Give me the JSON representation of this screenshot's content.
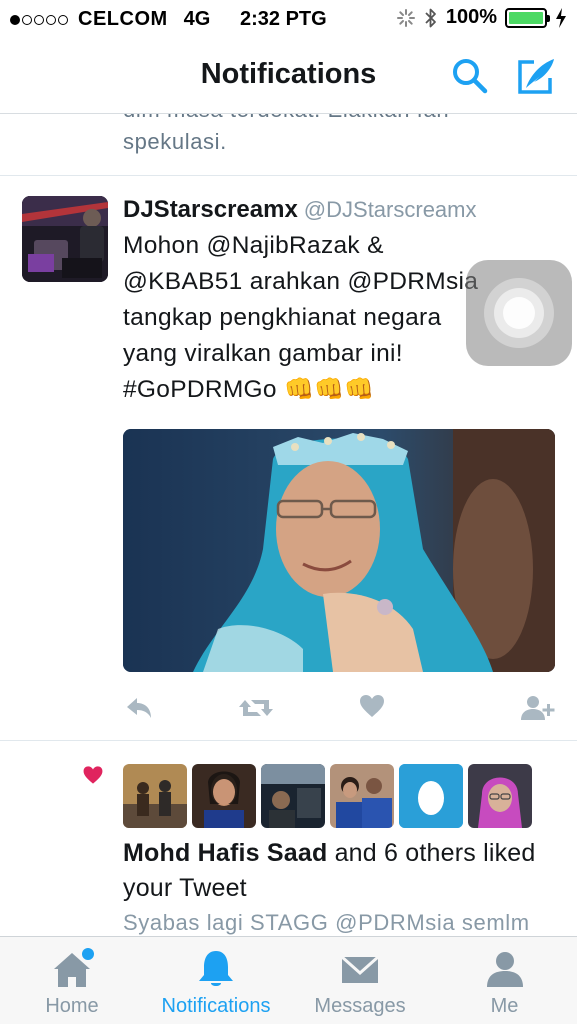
{
  "status_bar": {
    "signal_bars_filled": 1,
    "signal_bars_total": 5,
    "carrier": "CELCOM",
    "network": "4G",
    "time": "2:32 PTG",
    "battery": "100%",
    "battery_level": 1.0
  },
  "header": {
    "title": "Notifications",
    "search_icon": "search-icon",
    "compose_icon": "compose-icon"
  },
  "previous_tweet": {
    "text_line1": "dlm masa terdekat. Elakkan fan",
    "text_line2": "spekulasi."
  },
  "tweet": {
    "name": "DJStarscreamx",
    "handle": "@DJStarscreamx",
    "lines": [
      "Mohon @NajibRazak &",
      "@KBAB51 arahkan @PDRMsia",
      "tangkap pengkhianat negara",
      "yang viralkan gambar ini!"
    ],
    "hashtag": "#GoPDRMGo",
    "emoji": [
      "👊",
      "👊",
      "👊"
    ],
    "actions": [
      "reply-icon",
      "retweet-icon",
      "like-icon",
      "follow-icon"
    ]
  },
  "like_notification": {
    "name": "Mohd Hafis Saad",
    "text": " and 6 others liked your Tweet",
    "preview": "Syabas lagi STAGG @PDRMsia semlm",
    "avatar_count": 6
  },
  "tabs": [
    {
      "label": "Home",
      "icon": "home-icon",
      "active": false,
      "badge": true
    },
    {
      "label": "Notifications",
      "icon": "bell-icon",
      "active": true,
      "badge": false
    },
    {
      "label": "Messages",
      "icon": "envelope-icon",
      "active": false,
      "badge": false
    },
    {
      "label": "Me",
      "icon": "person-icon",
      "active": false,
      "badge": false
    }
  ],
  "colors": {
    "accent": "#1da1f2",
    "like_red": "#e0245e",
    "battery_green": "#4cd964",
    "icon_gray": "#aab8c2",
    "text_gray": "#8899a6"
  }
}
